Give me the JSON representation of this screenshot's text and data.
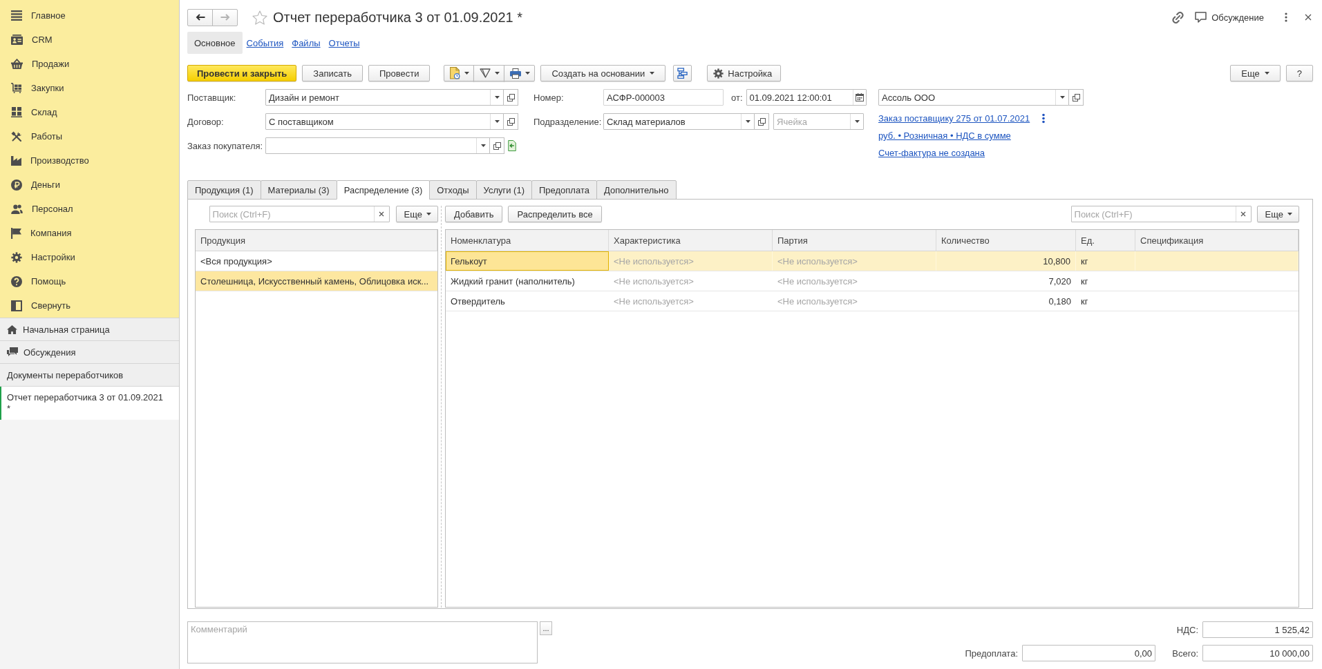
{
  "sidebar": {
    "sections": [
      {
        "label": "Главное"
      },
      {
        "label": "CRM"
      },
      {
        "label": "Продажи"
      },
      {
        "label": "Закупки"
      },
      {
        "label": "Склад"
      },
      {
        "label": "Работы"
      },
      {
        "label": "Производство"
      },
      {
        "label": "Деньги"
      },
      {
        "label": "Персонал"
      },
      {
        "label": "Компания"
      },
      {
        "label": "Настройки"
      },
      {
        "label": "Помощь"
      },
      {
        "label": "Свернуть"
      }
    ],
    "shortcuts": [
      {
        "label": "Начальная страница"
      },
      {
        "label": "Обсуждения"
      }
    ],
    "open_windows": {
      "group": "Документы переработчиков",
      "items": [
        {
          "label": "Отчет переработчика 3 от 01.09.2021 *",
          "selected": true
        }
      ]
    }
  },
  "navigation": [
    {
      "kind": "back",
      "disabled": false
    },
    {
      "kind": "forward",
      "disabled": true
    }
  ],
  "window": {
    "title": "Отчет переработчика 3 от 01.09.2021 *",
    "favorite": false,
    "discussion": "Обсуждение"
  },
  "form_tabs": [
    {
      "label": "Основное",
      "selected": true
    },
    {
      "label": "События",
      "selected": false
    },
    {
      "label": "Файлы",
      "selected": false
    },
    {
      "label": "Отчеты",
      "selected": false
    }
  ],
  "toolbar": {
    "items": [
      {
        "kind": "primary",
        "label": "Провести и закрыть"
      },
      {
        "kind": "button",
        "label": "Записать"
      },
      {
        "kind": "button",
        "label": "Провести"
      },
      {
        "kind": "icon_menus"
      },
      {
        "kind": "menu",
        "label": "Создать на основании"
      },
      {
        "kind": "icon"
      },
      {
        "kind": "settings",
        "label": "Настройка"
      }
    ],
    "right": [
      {
        "kind": "menu",
        "label": "Еще"
      },
      {
        "kind": "button",
        "label": "?"
      }
    ]
  },
  "header": {
    "supplier": {
      "label": "Поставщик:",
      "value": "Дизайн и ремонт"
    },
    "contract": {
      "label": "Договор:",
      "value": "С поставщиком"
    },
    "customer_order": {
      "label": "Заказ покупателя:"
    },
    "number": {
      "label": "Номер:",
      "value": "АСФР-000003"
    },
    "date": {
      "label": "от:",
      "value": "01.09.2021 12:00:01"
    },
    "department": {
      "label": "Подразделение:",
      "value": "Склад материалов"
    },
    "storage_cell": {
      "placeholder": "Ячейка"
    },
    "organization": {
      "value": "Ассоль ООО"
    },
    "links": [
      "Заказ поставщику 275 от 01.07.2021",
      "руб. • Розничная • НДС в сумме",
      "Счет-фактура не создана"
    ]
  },
  "tabs": [
    {
      "label": "Продукция (1)",
      "selected": false
    },
    {
      "label": "Материалы (3)",
      "selected": false
    },
    {
      "label": "Распределение (3)",
      "selected": true
    },
    {
      "label": "Отходы",
      "selected": false
    },
    {
      "label": "Услуги (1)",
      "selected": false
    },
    {
      "label": "Предоплата",
      "selected": false
    },
    {
      "label": "Дополнительно",
      "selected": false
    }
  ],
  "products": {
    "search": {
      "placeholder": "Поиск (Ctrl+F)"
    },
    "more": "Еще",
    "column": "Продукция",
    "rows": [
      {
        "text": "<Вся продукция>",
        "selected": false
      },
      {
        "text": "Столешница, Искусственный камень, Облицовка иск...",
        "selected": true
      }
    ]
  },
  "distribution": {
    "buttons": [
      "Добавить",
      "Распределить все"
    ],
    "search": {
      "placeholder": "Поиск (Ctrl+F)"
    },
    "more": "Еще",
    "columns": [
      "Номенклатура",
      "Характеристика",
      "Партия",
      "Количество",
      "Ед.",
      "Спецификация"
    ],
    "rows": [
      {
        "nomenclature": "Гелькоут",
        "characteristic": "<Не используется>",
        "batch": "<Не используется>",
        "quantity": "10,800",
        "unit": "кг",
        "selected": true
      },
      {
        "nomenclature": "Жидкий гранит (наполнитель)",
        "characteristic": "<Не используется>",
        "batch": "<Не используется>",
        "quantity": "7,020",
        "unit": "кг",
        "selected": false
      },
      {
        "nomenclature": "Отвердитель",
        "characteristic": "<Не используется>",
        "batch": "<Не используется>",
        "quantity": "0,180",
        "unit": "кг",
        "selected": false
      }
    ]
  },
  "footer": {
    "comment": {
      "placeholder": "Комментарий",
      "button": "..."
    },
    "vat": {
      "label": "НДС:",
      "value": "1 525,42"
    },
    "prepayment": {
      "label": "Предоплата:",
      "value": "0,00"
    },
    "total": {
      "label": "Всего:",
      "value": "10 000,00"
    }
  }
}
